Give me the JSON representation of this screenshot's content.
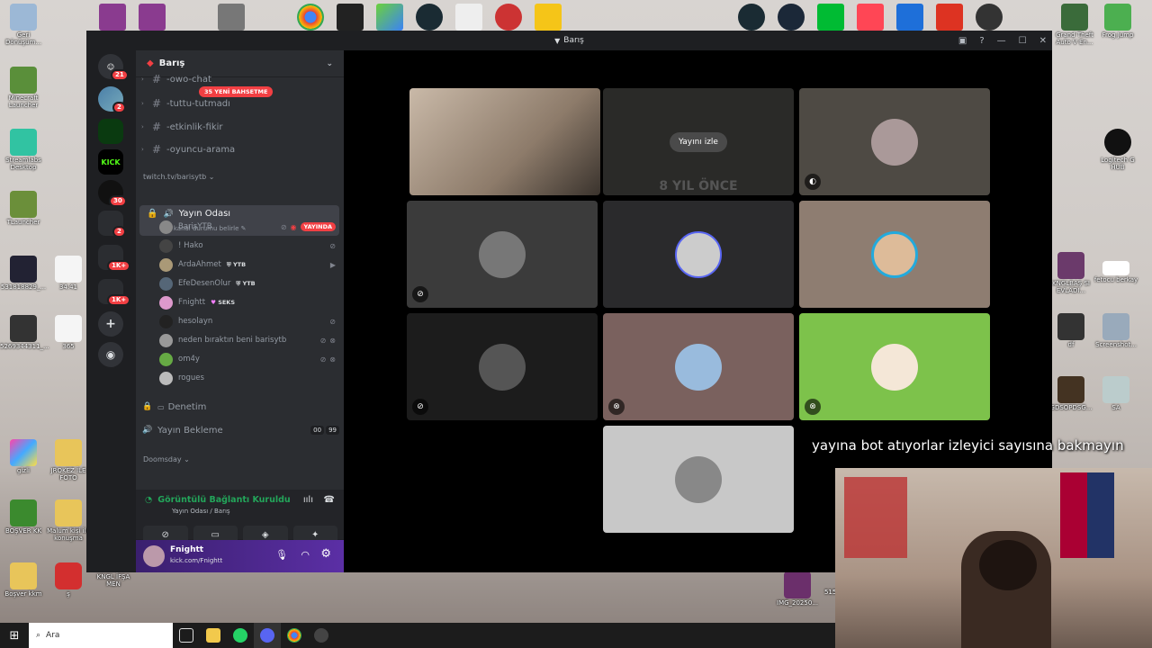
{
  "window": {
    "title": "Barış"
  },
  "guilds": {
    "badges": [
      "21",
      "2",
      "30",
      "2",
      "1K+",
      "1K+"
    ],
    "kick_label": "KICK"
  },
  "server": {
    "name": "Barış",
    "channels": [
      {
        "label": "-owo-chat"
      },
      {
        "label": "-tuttu-tutmadı",
        "badge": "35 YENİ BAHSETME"
      },
      {
        "label": "-etkinlik-fikir"
      },
      {
        "label": "-oyuncu-arama"
      }
    ],
    "category_twitch": "twitch.tv/barisytb",
    "voice_channel": {
      "name": "Yayın Odası",
      "status_placeholder": "Bir kanal durumu belirle"
    },
    "members": [
      {
        "name": "BarisYTB",
        "live": "YAYINDA"
      },
      {
        "name": "! Hako"
      },
      {
        "name": "ArdaAhmet",
        "tag": "YTB"
      },
      {
        "name": "EfeDesenOlur",
        "tag": "YTB"
      },
      {
        "name": "Fnightt",
        "tag": "SEKS"
      },
      {
        "name": "hesolayn"
      },
      {
        "name": "neden bıraktın beni barisytb"
      },
      {
        "name": "om4y"
      },
      {
        "name": "rogues"
      }
    ],
    "more_channels": [
      {
        "label": "Denetim"
      },
      {
        "label": "Yayın Bekleme",
        "counter_a": "00",
        "counter_b": "99"
      }
    ],
    "category_doomsday": "Doomsday"
  },
  "voice_panel": {
    "status": "Görüntülü Bağlantı Kuruldu",
    "location": "Yayın Odası / Barış"
  },
  "user_panel": {
    "name": "Fnightt",
    "status": "kick.com/Fnightt"
  },
  "stage": {
    "watch_stream_label": "Yayını izle",
    "stream_overlay_text": "8 YIL ÖNCE"
  },
  "overlay": {
    "caption": "yayına bot atıyorlar izleyici sayısına bakmayın"
  },
  "desktop": {
    "icons_left": [
      "Geri Dönüşüm...",
      "Minecraft Launcher",
      "Streamlabs Desktop",
      "TLauncher",
      "531818829_...",
      "34.41",
      "5269344311_...",
      "365",
      "gizli",
      "JROKEZ İLE FOTO",
      "BOŞVER KK",
      "Malum kişi ile konuşma",
      "Boşver kkm",
      "ş",
      "KNGL İFŞA MEN"
    ],
    "icons_right": [
      "Grand Theft Auto V En...",
      "Frog Jump",
      "Logitech G HUB",
      "KNGLBAŞ SI EVLADI...",
      "fetocu berkay",
      "df",
      "Screenshot...",
      "GDSOPDSG...",
      "SA",
      "IMG_20250...",
      "515..."
    ]
  },
  "taskbar": {
    "search_placeholder": "Ara"
  },
  "colors": {
    "accent_green": "#23a55a",
    "live_red": "#f23f43",
    "sidebar_bg": "#2b2d31",
    "guild_bg": "#1e1f22"
  }
}
